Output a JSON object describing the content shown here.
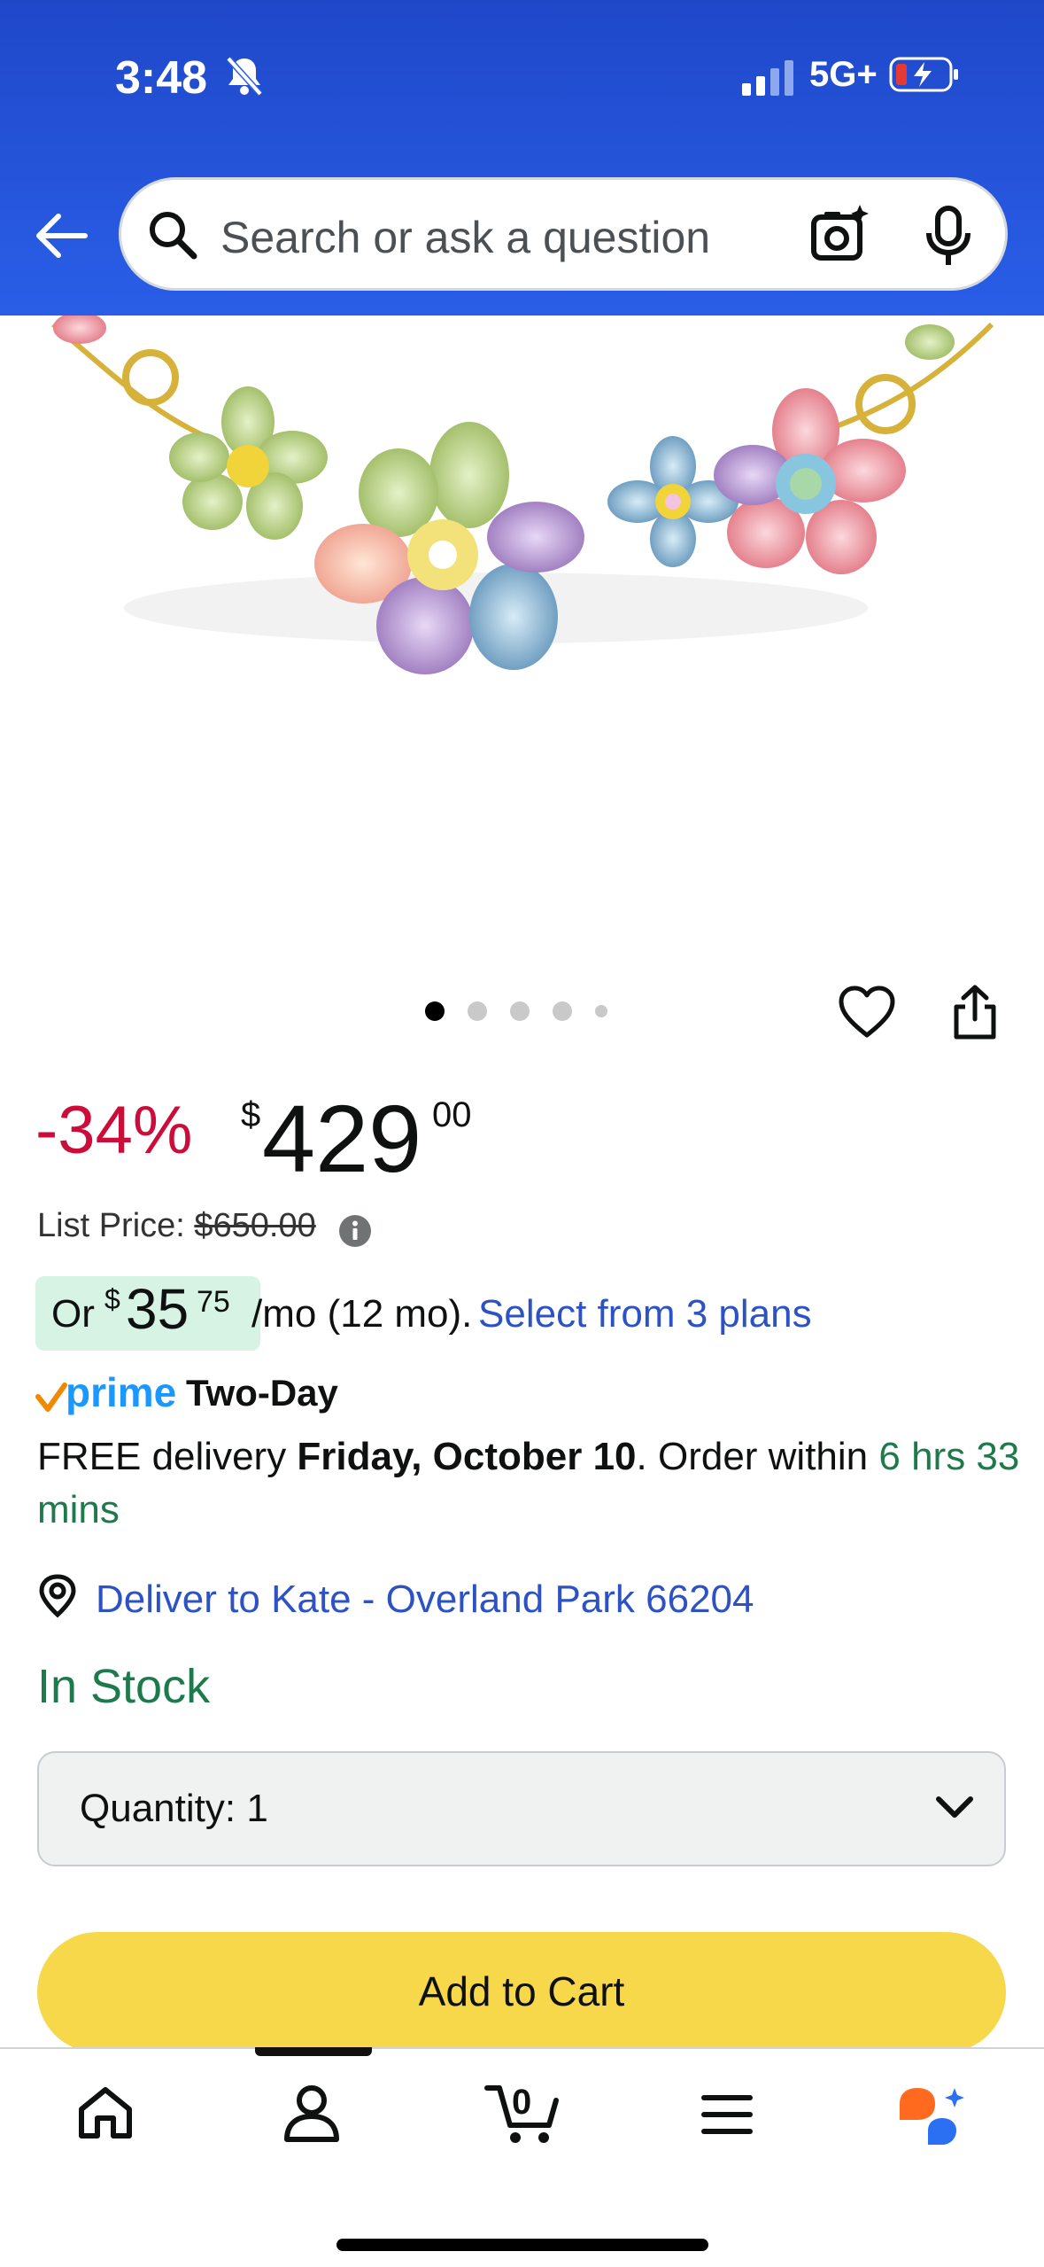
{
  "status_bar": {
    "time": "3:48",
    "network": "5G+"
  },
  "search": {
    "placeholder": "Search or ask a question"
  },
  "carousel": {
    "count": 5,
    "active_index": 0
  },
  "price": {
    "discount": "-34%",
    "symbol": "$",
    "whole": "429",
    "fraction": "00",
    "list_price_label": "List Price:",
    "list_price_value": "$650.00"
  },
  "monthly": {
    "or": "Or",
    "symbol": "$",
    "whole": "35",
    "fraction": "75",
    "rest": "/mo (12 mo).",
    "link": "Select from 3 plans"
  },
  "shipping": {
    "prime": "prime",
    "speed": "Two-Day",
    "free_delivery": "FREE delivery",
    "date": "Friday, October 10",
    "order_within": ". Order within",
    "countdown": "6 hrs 33 mins"
  },
  "deliver_to": "Deliver to Kate - Overland Park 66204",
  "stock": "In Stock",
  "quantity": {
    "label": "Quantity:",
    "value": "1"
  },
  "add_to_cart": "Add to Cart",
  "nav": {
    "cart_count": "0"
  },
  "colors": {
    "header": "#2a5ee8",
    "discount": "#cc0c39",
    "link": "#2d52c4",
    "green": "#1e7a4c",
    "cart_button": "#f7d84a"
  }
}
